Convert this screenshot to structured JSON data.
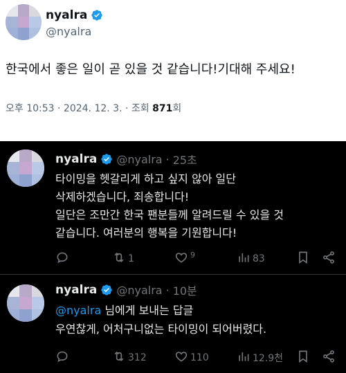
{
  "main_tweet": {
    "author_name": "nyalra",
    "handle": "@nyalra",
    "text": "한국에서 좋은 일이 곧 있을 것 같습니다!기대해 주세요!",
    "time": "오후 10:53",
    "separator": "·",
    "date": "2024. 12. 3.",
    "views_label": "조회",
    "views_count": "871",
    "views_suffix": "회"
  },
  "replies": [
    {
      "author_name": "nyalra",
      "handle": "@nyalra",
      "separator": "·",
      "time": "25초",
      "lines": [
        "타이밍을 헷갈리게 하고 싶지 않아 일단",
        "삭제하겠습니다, 죄송합니다!",
        "일단은 조만간 한국 팬분들께 알려드릴 수 있을 것",
        "같습니다. 여러분의 행복을 기원합니다!"
      ],
      "stats": {
        "replies": "",
        "reposts": "1",
        "likes": "9",
        "views": "83"
      }
    },
    {
      "author_name": "nyalra",
      "handle": "@nyalra",
      "separator": "·",
      "time": "10분",
      "replying_mention": "@nyalra",
      "replying_suffix": " 님에게 보내는 답글",
      "lines": [
        "우연찮게, 어처구니없는 타이밍이 되어버렸다."
      ],
      "stats": {
        "replies": "",
        "reposts": "312",
        "likes": "110",
        "views": "12.9천"
      }
    }
  ],
  "colors": {
    "accent": "#1d9bf0",
    "muted": "#71767b",
    "dark_bg": "#000000",
    "light_bg": "#ffffff"
  },
  "icons": [
    "verified-badge-icon",
    "reply-icon",
    "repost-icon",
    "like-icon",
    "views-icon",
    "bookmark-icon",
    "share-icon"
  ]
}
